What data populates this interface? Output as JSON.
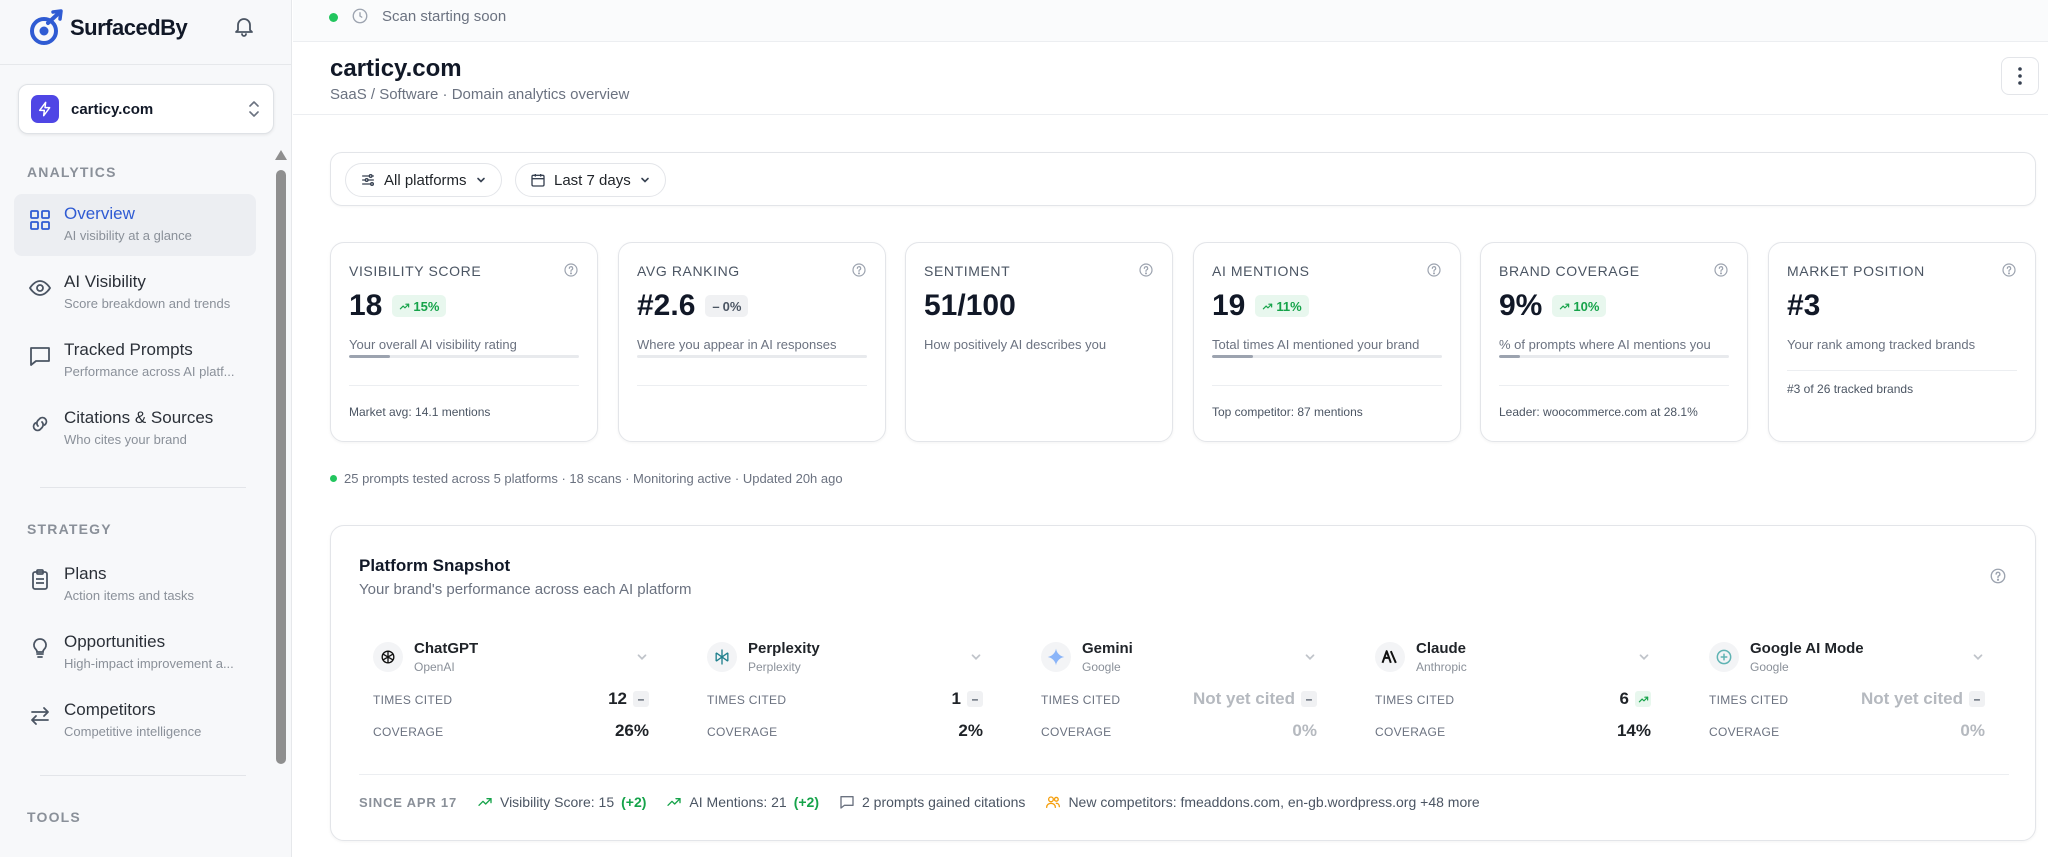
{
  "brand": {
    "name": "SurfacedBy"
  },
  "domain_selector": {
    "domain": "carticy.com"
  },
  "sidebar": {
    "sections": [
      {
        "label": "ANALYTICS"
      },
      {
        "label": "STRATEGY"
      },
      {
        "label": "TOOLS"
      }
    ],
    "items": [
      {
        "title": "Overview",
        "subtitle": "AI visibility at a glance",
        "icon": "grid-icon",
        "active": true
      },
      {
        "title": "AI Visibility",
        "subtitle": "Score breakdown and trends",
        "icon": "eye-icon"
      },
      {
        "title": "Tracked Prompts",
        "subtitle": "Performance across AI platf...",
        "icon": "chat-icon"
      },
      {
        "title": "Citations & Sources",
        "subtitle": "Who cites your brand",
        "icon": "link-icon"
      },
      {
        "title": "Plans",
        "subtitle": "Action items and tasks",
        "icon": "clipboard-icon"
      },
      {
        "title": "Opportunities",
        "subtitle": "High-impact improvement a...",
        "icon": "lightbulb-icon"
      },
      {
        "title": "Competitors",
        "subtitle": "Competitive intelligence",
        "icon": "arrows-icon"
      }
    ]
  },
  "topbar": {
    "status": "Scan starting soon"
  },
  "header": {
    "title": "carticy.com",
    "subtitle": "SaaS / Software · Domain analytics overview"
  },
  "filters": {
    "platforms": "All platforms",
    "range": "Last 7 days"
  },
  "metrics": [
    {
      "label": "VISIBILITY SCORE",
      "value": "18",
      "badge": "15%",
      "trend": "up",
      "desc": "Your overall AI visibility rating",
      "progress": 0.18,
      "foot": "Market avg: 14.1 mentions"
    },
    {
      "label": "AVG RANKING",
      "value": "#2.6",
      "badge": "0%",
      "trend": "flat",
      "desc": "Where you appear in AI responses",
      "progress": 0.0,
      "foot": ""
    },
    {
      "label": "SENTIMENT",
      "value": "51/100",
      "badge": "",
      "trend": "",
      "desc": "How positively AI describes you",
      "progress": null,
      "foot": ""
    },
    {
      "label": "AI MENTIONS",
      "value": "19",
      "badge": "11%",
      "trend": "up",
      "desc": "Total times AI mentioned your brand",
      "progress": 0.18,
      "foot": "Top competitor: 87 mentions"
    },
    {
      "label": "BRAND COVERAGE",
      "value": "9%",
      "badge": "10%",
      "trend": "up",
      "desc": "% of prompts where AI mentions you",
      "progress": 0.09,
      "foot": "Leader: woocommerce.com at 28.1%"
    },
    {
      "label": "MARKET POSITION",
      "value": "#3",
      "badge": "",
      "trend": "",
      "desc": "Your rank among tracked brands",
      "progress": null,
      "foot": "#3 of 26 tracked brands"
    }
  ],
  "summary": "25 prompts tested across 5 platforms · 18 scans · Monitoring active · Updated 20h ago",
  "snapshot": {
    "title": "Platform Snapshot",
    "subtitle": "Your brand's performance across each AI platform",
    "times_cited_label": "TIMES CITED",
    "coverage_label": "COVERAGE",
    "platforms": [
      {
        "name": "ChatGPT",
        "vendor": "OpenAI",
        "times_cited": "12",
        "trend": "flat",
        "coverage": "26%"
      },
      {
        "name": "Perplexity",
        "vendor": "Perplexity",
        "times_cited": "1",
        "trend": "flat",
        "coverage": "2%"
      },
      {
        "name": "Gemini",
        "vendor": "Google",
        "times_cited": "Not yet cited",
        "trend": "flat",
        "coverage": "0%"
      },
      {
        "name": "Claude",
        "vendor": "Anthropic",
        "times_cited": "6",
        "trend": "up",
        "coverage": "14%"
      },
      {
        "name": "Google AI Mode",
        "vendor": "Google",
        "times_cited": "Not yet cited",
        "trend": "flat",
        "coverage": "0%"
      }
    ],
    "since": {
      "label": "SINCE APR 17",
      "visibility": "Visibility Score: 15",
      "visibility_delta": "(+2)",
      "mentions": "AI Mentions: 21",
      "mentions_delta": "(+2)",
      "prompts": "2 prompts gained citations",
      "competitors": "New competitors: fmeaddons.com, en-gb.wordpress.org +48 more"
    }
  },
  "colors": {
    "accent": "#2f5bd3",
    "brand": "#4f46e5",
    "positive": "#16a34a",
    "status": "#22c55e"
  }
}
